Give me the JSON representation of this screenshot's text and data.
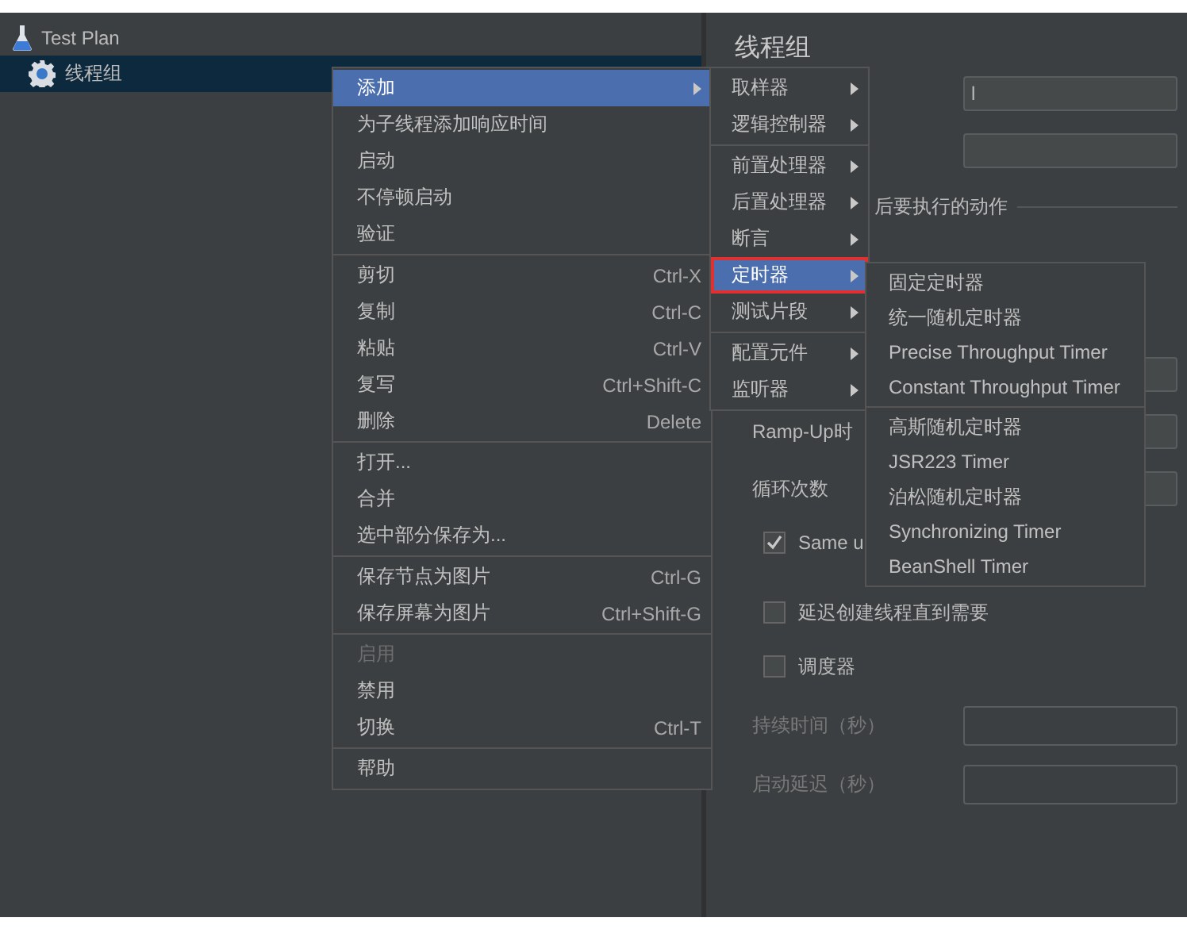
{
  "tree": [
    {
      "label": "Test Plan",
      "selected": false,
      "children": [
        {
          "label": "线程组",
          "selected": true
        }
      ]
    }
  ],
  "panel": {
    "title": "线程组",
    "name_field": {
      "value": "l"
    },
    "action_section": {
      "label": "后要执行的动作"
    },
    "ramp_up": {
      "label": "Ramp-Up时"
    },
    "loops": {
      "label": "循环次数"
    },
    "checkboxes": [
      {
        "label": "Same u",
        "checked": true
      },
      {
        "label": "延迟创建线程直到需要",
        "checked": false
      },
      {
        "label": "调度器",
        "checked": false
      }
    ],
    "scheduler_fields": [
      {
        "label": "持续时间（秒）",
        "disabled": true
      },
      {
        "label": "启动延迟（秒）",
        "disabled": true
      }
    ]
  },
  "context_menu": {
    "groups": [
      [
        {
          "label": "添加",
          "submenu": true,
          "selected": true,
          "disabled": false
        },
        {
          "label": "为子线程添加响应时间",
          "submenu": false,
          "selected": false,
          "disabled": false
        },
        {
          "label": "启动",
          "submenu": false,
          "selected": false,
          "disabled": false
        },
        {
          "label": "不停顿启动",
          "submenu": false,
          "selected": false,
          "disabled": false
        },
        {
          "label": "验证",
          "submenu": false,
          "selected": false,
          "disabled": false
        }
      ],
      [
        {
          "label": "剪切",
          "shortcut": "Ctrl-X",
          "submenu": false,
          "selected": false,
          "disabled": false
        },
        {
          "label": "复制",
          "shortcut": "Ctrl-C",
          "submenu": false,
          "selected": false,
          "disabled": false
        },
        {
          "label": "粘贴",
          "shortcut": "Ctrl-V",
          "submenu": false,
          "selected": false,
          "disabled": false
        },
        {
          "label": "复写",
          "shortcut": "Ctrl+Shift-C",
          "submenu": false,
          "selected": false,
          "disabled": false
        },
        {
          "label": "删除",
          "shortcut": "Delete",
          "submenu": false,
          "selected": false,
          "disabled": false
        }
      ],
      [
        {
          "label": "打开...",
          "submenu": false,
          "selected": false,
          "disabled": false
        },
        {
          "label": "合并",
          "submenu": false,
          "selected": false,
          "disabled": false
        },
        {
          "label": "选中部分保存为...",
          "submenu": false,
          "selected": false,
          "disabled": false
        }
      ],
      [
        {
          "label": "保存节点为图片",
          "shortcut": "Ctrl-G",
          "submenu": false,
          "selected": false,
          "disabled": false
        },
        {
          "label": "保存屏幕为图片",
          "shortcut": "Ctrl+Shift-G",
          "submenu": false,
          "selected": false,
          "disabled": false
        }
      ],
      [
        {
          "label": "启用",
          "submenu": false,
          "selected": false,
          "disabled": true
        },
        {
          "label": "禁用",
          "submenu": false,
          "selected": false,
          "disabled": false
        },
        {
          "label": "切换",
          "shortcut": "Ctrl-T",
          "submenu": false,
          "selected": false,
          "disabled": false
        }
      ],
      [
        {
          "label": "帮助",
          "submenu": false,
          "selected": false,
          "disabled": false
        }
      ]
    ]
  },
  "add_menu": {
    "groups": [
      [
        {
          "label": "取样器",
          "submenu": true,
          "selected": false
        },
        {
          "label": "逻辑控制器",
          "submenu": true,
          "selected": false
        }
      ],
      [
        {
          "label": "前置处理器",
          "submenu": true,
          "selected": false
        },
        {
          "label": "后置处理器",
          "submenu": true,
          "selected": false
        },
        {
          "label": "断言",
          "submenu": true,
          "selected": false
        },
        {
          "label": "定时器",
          "submenu": true,
          "selected": true
        },
        {
          "label": "测试片段",
          "submenu": true,
          "selected": false
        }
      ],
      [
        {
          "label": "配置元件",
          "submenu": true,
          "selected": false
        },
        {
          "label": "监听器",
          "submenu": true,
          "selected": false
        }
      ]
    ]
  },
  "timer_menu": {
    "groups": [
      [
        {
          "label": "固定定时器",
          "selected": false
        },
        {
          "label": "统一随机定时器",
          "selected": false
        },
        {
          "label": "Precise Throughput Timer",
          "selected": false
        },
        {
          "label": "Constant Throughput Timer",
          "selected": false
        }
      ],
      [
        {
          "label": "高斯随机定时器",
          "selected": false
        },
        {
          "label": "JSR223 Timer",
          "selected": false
        },
        {
          "label": "泊松随机定时器",
          "selected": false
        },
        {
          "label": "Synchronizing Timer",
          "selected": false
        },
        {
          "label": "BeanShell Timer",
          "selected": false
        }
      ]
    ]
  }
}
